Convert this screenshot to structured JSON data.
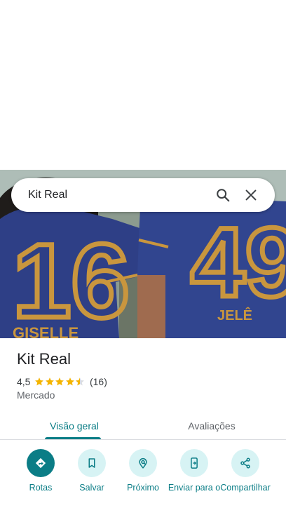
{
  "search": {
    "query": "Kit Real"
  },
  "photo": {
    "jersey_left_number": "16",
    "jersey_left_name": "GISELLE",
    "jersey_right_number": "49",
    "jersey_right_name": "JELÊ"
  },
  "place": {
    "name": "Kit Real",
    "rating": "4,5",
    "rating_value": 4.5,
    "reviews_count": "(16)",
    "category": "Mercado"
  },
  "tabs": [
    {
      "label": "Visão geral",
      "active": true
    },
    {
      "label": "Avaliações",
      "active": false
    }
  ],
  "actions": [
    {
      "label": "Rotas",
      "icon": "directions-icon"
    },
    {
      "label": "Salvar",
      "icon": "bookmark-icon"
    },
    {
      "label": "Próximo",
      "icon": "nearby-icon"
    },
    {
      "label": "Enviar para o",
      "icon": "send-to-phone-icon"
    },
    {
      "label": "Compartilhar",
      "icon": "share-icon"
    }
  ],
  "colors": {
    "accent": "#0b7d86",
    "accent_light": "#d7f3f4",
    "star": "#f4b400",
    "jersey": "#2b3a78",
    "gold": "#c9963e"
  }
}
